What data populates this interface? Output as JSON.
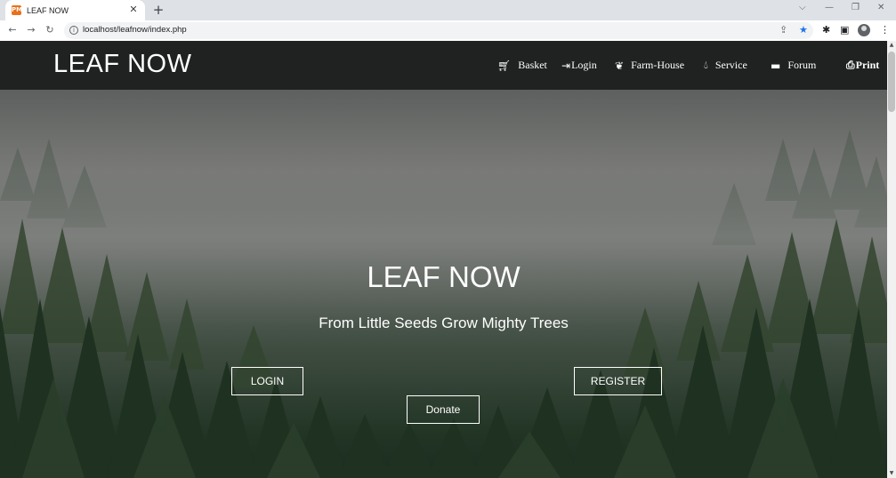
{
  "browser": {
    "tab_title": "LEAF NOW",
    "favicon_text": "PM",
    "url": "localhost/leafnow/index.php",
    "icons": [
      "close-icon",
      "plus-icon",
      "back-arrow-icon",
      "forward-arrow-icon",
      "reload-icon",
      "info-icon",
      "share-icon",
      "star-icon",
      "puzzle-icon",
      "side-panel-icon",
      "profile-icon",
      "kebab-menu-icon"
    ]
  },
  "navbar": {
    "brand": "LEAF NOW",
    "items": [
      {
        "label": "Basket",
        "icon": "cart-icon"
      },
      {
        "label": "Login",
        "icon": "sign-in-icon"
      },
      {
        "label": "Farm-House",
        "icon": "leaf-icon"
      },
      {
        "label": "Service",
        "icon": "drop-icon"
      },
      {
        "label": "Forum",
        "icon": "comment-icon"
      },
      {
        "label": "Print",
        "icon": "print-icon"
      }
    ]
  },
  "hero": {
    "title": "LEAF NOW",
    "subtitle": "From Little Seeds Grow Mighty Trees",
    "login_label": "LOGIN",
    "register_label": "REGISTER",
    "donate_label": "Donate"
  },
  "colors": {
    "navbar_bg": "#1f2220",
    "text": "#ffffff",
    "star_accent": "#1a73e8"
  }
}
